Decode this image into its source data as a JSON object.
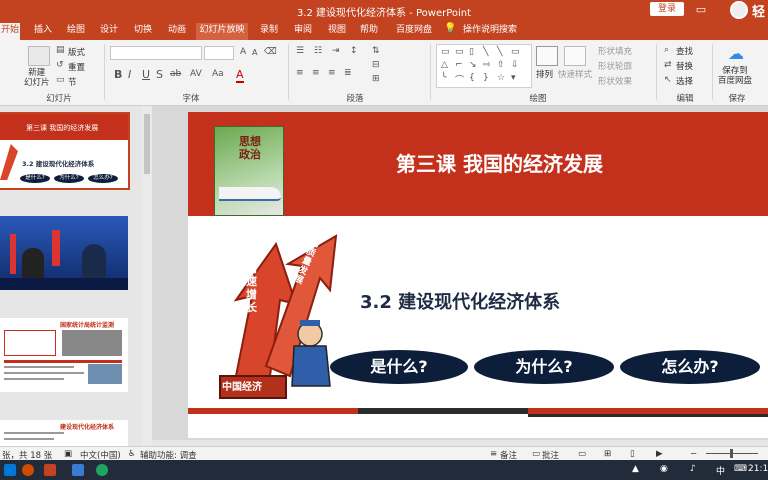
{
  "window": {
    "title": "3.2 建设现代化经济体系 - PowerPoint",
    "login_label": "登录",
    "light_char": "轻"
  },
  "tabs": [
    "开始",
    "插入",
    "绘图",
    "设计",
    "切换",
    "动画",
    "幻灯片放映",
    "录制",
    "审阅",
    "视图",
    "帮助",
    "百度网盘"
  ],
  "active_tab": "开始",
  "tell_me": "操作说明搜索",
  "ribbon": {
    "new_slide": "新建\n幻灯片",
    "layout": "版式",
    "reset": "重置",
    "section": "节",
    "groups": [
      "幻灯片",
      "字体",
      "段落",
      "绘图",
      "编辑",
      "保存"
    ],
    "arrange": "排列",
    "quick_styles": "快速样式",
    "shape_fill": "形状填充",
    "shape_outline": "形状轮廓",
    "shape_effects": "形状效果",
    "find": "查找",
    "replace": "替换",
    "select": "选择",
    "save_to_baidu": "保存到\n百度网盘",
    "font_buttons": [
      "B",
      "I",
      "U",
      "S",
      "ab",
      "AV",
      "Aa",
      "A"
    ]
  },
  "thumbnails": {
    "slide1": {
      "title": "第三课  我国的经济发展",
      "subtitle": "3.2  建设现代化经济体系",
      "pills": [
        "是什么?",
        "为什么?",
        "怎么办?"
      ]
    },
    "slide3_title": "国家统计局统计监测",
    "slide4_title": "建设现代化经济体系"
  },
  "slide": {
    "book_title": "思想\n政治",
    "lesson_title": "第三课   我国的经济发展",
    "section_title": "3.2    建设现代化经济体系",
    "arrow_text1": "高速增长",
    "arrow_text2": "高质量发展",
    "pedestal": "中国经济",
    "pills": [
      "是什么?",
      "为什么?",
      "怎么办?"
    ]
  },
  "statusbar": {
    "slide_count": "张，共 18 张",
    "language": "中文(中国)",
    "accessibility": "辅助功能: 调查",
    "notes": "备注",
    "comments": "批注"
  },
  "taskbar": {
    "ime": "中",
    "time": "21:1"
  },
  "colors": {
    "accent": "#c3421f",
    "slide_red": "#c3311c",
    "pill_navy": "#0c1e3a"
  }
}
